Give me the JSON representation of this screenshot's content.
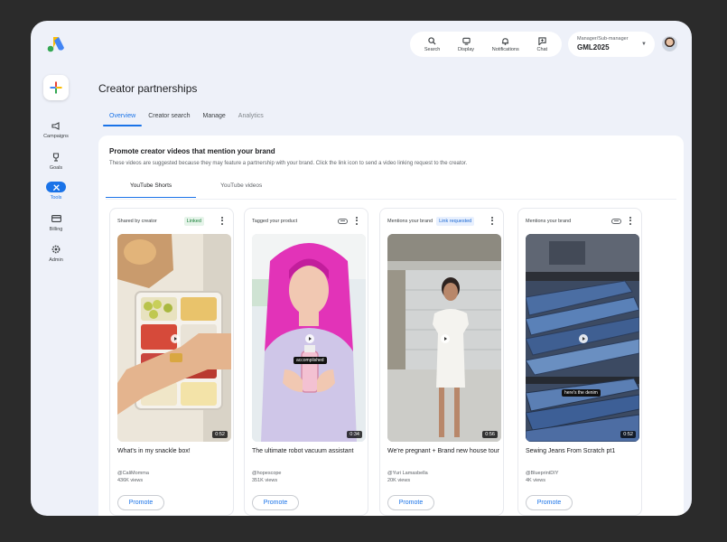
{
  "topnav": [
    {
      "label": "Search",
      "icon": "search-icon"
    },
    {
      "label": "Display",
      "icon": "display-icon"
    },
    {
      "label": "Notifications",
      "icon": "bell-icon"
    },
    {
      "label": "Chat",
      "icon": "chat-icon"
    }
  ],
  "account": {
    "role": "Manager/Sub-manager",
    "id": "GML2025"
  },
  "rail": [
    {
      "label": "Campaigns",
      "icon": "megaphone-icon"
    },
    {
      "label": "Goals",
      "icon": "trophy-icon"
    },
    {
      "label": "Tools",
      "icon": "tools-icon",
      "active": true
    },
    {
      "label": "Billing",
      "icon": "credit-card-icon"
    },
    {
      "label": "Admin",
      "icon": "gear-icon"
    }
  ],
  "page": {
    "title": "Creator partnerships"
  },
  "tabs": [
    "Overview",
    "Creator search",
    "Manage",
    "Analytics"
  ],
  "panel": {
    "title": "Promote creator videos that mention your brand",
    "subtitle": "These videos are suggested because they may feature a partnership with your brand. Click the link icon to send a video linking request to the creator.",
    "subtabs": [
      "YouTube Shorts",
      "YouTube videos"
    ]
  },
  "cards": [
    {
      "tag": "Shared by creator",
      "chip": "Linked",
      "duration": "0:52",
      "title": "What's in my snackle box!",
      "handle": "@CaliMomma",
      "views": "436K views",
      "promote": "Promote"
    },
    {
      "tag": "Tagged your product",
      "duration": "0:34",
      "overlay": "accomplished",
      "title": "The ultimate robot vacuum assistant",
      "handle": "@hopescope",
      "views": "351K views",
      "promote": "Promote"
    },
    {
      "tag": "Mentions your brand",
      "chip": "Link requested",
      "duration": "0:56",
      "title": "We're pregnant + Brand new house tour",
      "handle": "@Yuri Lamasbella",
      "views": "20K views",
      "promote": "Promote"
    },
    {
      "tag": "Mentions your brand",
      "duration": "0:52",
      "overlay": "here's the denim",
      "title": "Sewing Jeans From Scratch pt1",
      "handle": "@BlueprintDIY",
      "views": "4K views",
      "promote": "Promote"
    }
  ],
  "colors": {
    "accent": "#1a73e8",
    "background": "#eef1f9",
    "linked": "#188038"
  }
}
